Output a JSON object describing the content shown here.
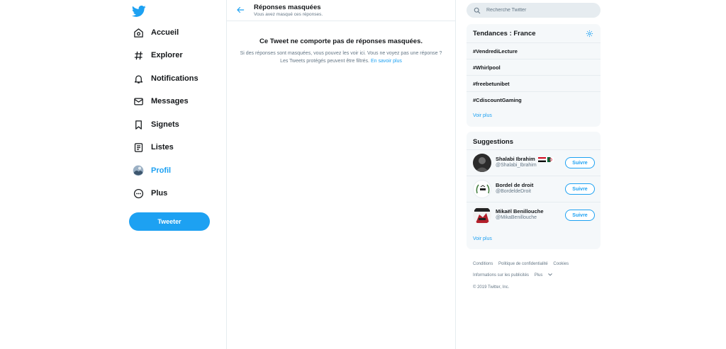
{
  "nav": {
    "items": [
      {
        "label": "Accueil",
        "icon": "home-icon"
      },
      {
        "label": "Explorer",
        "icon": "hashtag-icon"
      },
      {
        "label": "Notifications",
        "icon": "bell-icon"
      },
      {
        "label": "Messages",
        "icon": "envelope-icon"
      },
      {
        "label": "Signets",
        "icon": "bookmark-icon"
      },
      {
        "label": "Listes",
        "icon": "list-icon"
      },
      {
        "label": "Profil",
        "icon": "avatar-icon"
      },
      {
        "label": "Plus",
        "icon": "more-icon"
      }
    ],
    "tweet_button": "Tweeter"
  },
  "main": {
    "title": "Réponses masquées",
    "subtitle": "Vous avez masqué ces réponses.",
    "empty_title": "Ce Tweet ne comporte pas de réponses masquées.",
    "empty_text": "Si des réponses sont masquées, vous pouvez les voir ici. Vous ne voyez pas une réponse ? Les Tweets protégés peuvent être filtrés.",
    "learn_more": "En savoir plus"
  },
  "search": {
    "placeholder": "Recherche Twitter"
  },
  "trends": {
    "title": "Tendances : France",
    "items": [
      "#VendrediLecture",
      "#Whirlpool",
      "#freebetunibet",
      "#CdiscountGaming"
    ],
    "see_more": "Voir plus"
  },
  "suggestions": {
    "title": "Suggestions",
    "items": [
      {
        "name": "Shalabi Ibrahim",
        "handle": "@Shalabi_Ibrahim",
        "follow": "Suivre"
      },
      {
        "name": "Bordel de droit",
        "handle": "@BordeldeDroit",
        "follow": "Suivre"
      },
      {
        "name": "Mikaël Benillouche",
        "handle": "@MikaBenillouche",
        "follow": "Suivre"
      }
    ],
    "see_more": "Voir plus"
  },
  "footer": {
    "links_row1": [
      "Conditions",
      "Politique de confidentialité",
      "Cookies"
    ],
    "links_row2": [
      "Informations sur les publicités",
      "Plus"
    ],
    "copyright": "© 2019 Twitter, Inc."
  },
  "colors": {
    "accent": "#1da1f2",
    "text": "#14171a",
    "muted": "#657786",
    "panel": "#f5f8fa"
  }
}
